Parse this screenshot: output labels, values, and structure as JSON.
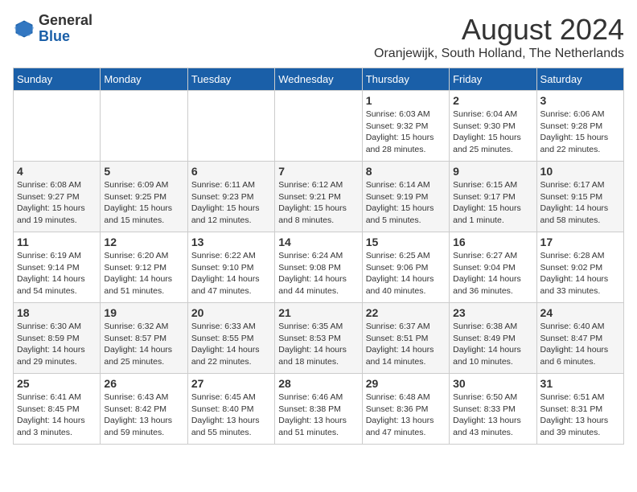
{
  "header": {
    "logo_general": "General",
    "logo_blue": "Blue",
    "month_title": "August 2024",
    "subtitle": "Oranjewijk, South Holland, The Netherlands"
  },
  "days_of_week": [
    "Sunday",
    "Monday",
    "Tuesday",
    "Wednesday",
    "Thursday",
    "Friday",
    "Saturday"
  ],
  "weeks": [
    [
      {
        "day": "",
        "info": ""
      },
      {
        "day": "",
        "info": ""
      },
      {
        "day": "",
        "info": ""
      },
      {
        "day": "",
        "info": ""
      },
      {
        "day": "1",
        "info": "Sunrise: 6:03 AM\nSunset: 9:32 PM\nDaylight: 15 hours\nand 28 minutes."
      },
      {
        "day": "2",
        "info": "Sunrise: 6:04 AM\nSunset: 9:30 PM\nDaylight: 15 hours\nand 25 minutes."
      },
      {
        "day": "3",
        "info": "Sunrise: 6:06 AM\nSunset: 9:28 PM\nDaylight: 15 hours\nand 22 minutes."
      }
    ],
    [
      {
        "day": "4",
        "info": "Sunrise: 6:08 AM\nSunset: 9:27 PM\nDaylight: 15 hours\nand 19 minutes."
      },
      {
        "day": "5",
        "info": "Sunrise: 6:09 AM\nSunset: 9:25 PM\nDaylight: 15 hours\nand 15 minutes."
      },
      {
        "day": "6",
        "info": "Sunrise: 6:11 AM\nSunset: 9:23 PM\nDaylight: 15 hours\nand 12 minutes."
      },
      {
        "day": "7",
        "info": "Sunrise: 6:12 AM\nSunset: 9:21 PM\nDaylight: 15 hours\nand 8 minutes."
      },
      {
        "day": "8",
        "info": "Sunrise: 6:14 AM\nSunset: 9:19 PM\nDaylight: 15 hours\nand 5 minutes."
      },
      {
        "day": "9",
        "info": "Sunrise: 6:15 AM\nSunset: 9:17 PM\nDaylight: 15 hours\nand 1 minute."
      },
      {
        "day": "10",
        "info": "Sunrise: 6:17 AM\nSunset: 9:15 PM\nDaylight: 14 hours\nand 58 minutes."
      }
    ],
    [
      {
        "day": "11",
        "info": "Sunrise: 6:19 AM\nSunset: 9:14 PM\nDaylight: 14 hours\nand 54 minutes."
      },
      {
        "day": "12",
        "info": "Sunrise: 6:20 AM\nSunset: 9:12 PM\nDaylight: 14 hours\nand 51 minutes."
      },
      {
        "day": "13",
        "info": "Sunrise: 6:22 AM\nSunset: 9:10 PM\nDaylight: 14 hours\nand 47 minutes."
      },
      {
        "day": "14",
        "info": "Sunrise: 6:24 AM\nSunset: 9:08 PM\nDaylight: 14 hours\nand 44 minutes."
      },
      {
        "day": "15",
        "info": "Sunrise: 6:25 AM\nSunset: 9:06 PM\nDaylight: 14 hours\nand 40 minutes."
      },
      {
        "day": "16",
        "info": "Sunrise: 6:27 AM\nSunset: 9:04 PM\nDaylight: 14 hours\nand 36 minutes."
      },
      {
        "day": "17",
        "info": "Sunrise: 6:28 AM\nSunset: 9:02 PM\nDaylight: 14 hours\nand 33 minutes."
      }
    ],
    [
      {
        "day": "18",
        "info": "Sunrise: 6:30 AM\nSunset: 8:59 PM\nDaylight: 14 hours\nand 29 minutes."
      },
      {
        "day": "19",
        "info": "Sunrise: 6:32 AM\nSunset: 8:57 PM\nDaylight: 14 hours\nand 25 minutes."
      },
      {
        "day": "20",
        "info": "Sunrise: 6:33 AM\nSunset: 8:55 PM\nDaylight: 14 hours\nand 22 minutes."
      },
      {
        "day": "21",
        "info": "Sunrise: 6:35 AM\nSunset: 8:53 PM\nDaylight: 14 hours\nand 18 minutes."
      },
      {
        "day": "22",
        "info": "Sunrise: 6:37 AM\nSunset: 8:51 PM\nDaylight: 14 hours\nand 14 minutes."
      },
      {
        "day": "23",
        "info": "Sunrise: 6:38 AM\nSunset: 8:49 PM\nDaylight: 14 hours\nand 10 minutes."
      },
      {
        "day": "24",
        "info": "Sunrise: 6:40 AM\nSunset: 8:47 PM\nDaylight: 14 hours\nand 6 minutes."
      }
    ],
    [
      {
        "day": "25",
        "info": "Sunrise: 6:41 AM\nSunset: 8:45 PM\nDaylight: 14 hours\nand 3 minutes."
      },
      {
        "day": "26",
        "info": "Sunrise: 6:43 AM\nSunset: 8:42 PM\nDaylight: 13 hours\nand 59 minutes."
      },
      {
        "day": "27",
        "info": "Sunrise: 6:45 AM\nSunset: 8:40 PM\nDaylight: 13 hours\nand 55 minutes."
      },
      {
        "day": "28",
        "info": "Sunrise: 6:46 AM\nSunset: 8:38 PM\nDaylight: 13 hours\nand 51 minutes."
      },
      {
        "day": "29",
        "info": "Sunrise: 6:48 AM\nSunset: 8:36 PM\nDaylight: 13 hours\nand 47 minutes."
      },
      {
        "day": "30",
        "info": "Sunrise: 6:50 AM\nSunset: 8:33 PM\nDaylight: 13 hours\nand 43 minutes."
      },
      {
        "day": "31",
        "info": "Sunrise: 6:51 AM\nSunset: 8:31 PM\nDaylight: 13 hours\nand 39 minutes."
      }
    ]
  ]
}
